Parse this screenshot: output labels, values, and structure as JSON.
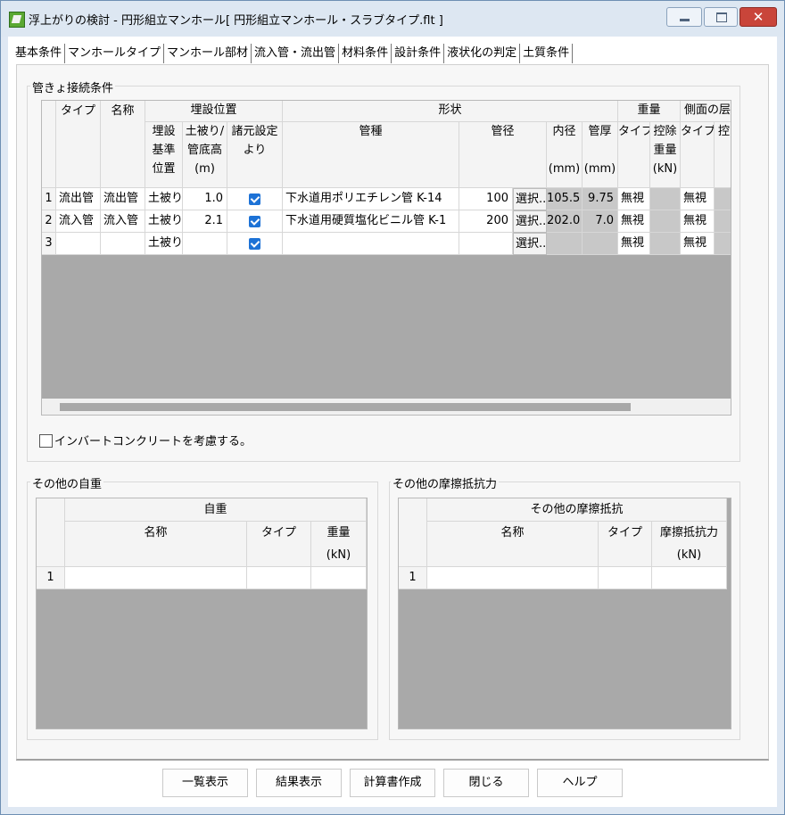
{
  "window": {
    "title": "浮上がりの検討 - 円形組立マンホール[ 円形組立マンホール・スラブタイプ.flt ]",
    "close_glyph": "✕",
    "icon": "app-icon"
  },
  "tabs": [
    "基本条件",
    "マンホールタイプ",
    "マンホール部材",
    "流入管・流出管",
    "材料条件",
    "設計条件",
    "液状化の判定",
    "土質条件"
  ],
  "active_tab": "流入管・流出管",
  "pipe_section": {
    "label": "管きょ接続条件",
    "header_groups": [
      "タイプ",
      "名称",
      "埋設位置",
      "形状",
      "重量",
      "側面の层"
    ],
    "sub_headers": {
      "burial_basis": [
        "埋設",
        "基準",
        "位置"
      ],
      "cover": [
        "土被り/",
        "管底高",
        "(m)"
      ],
      "from_settings": [
        "諸元設定",
        "より"
      ],
      "pipe_type": "管種",
      "pipe_dia": "管径",
      "inner_dia": [
        "内径",
        "(mm)"
      ],
      "thickness": [
        "管厚",
        "(mm)"
      ],
      "weight_type": "タイプ",
      "deduct_weight": [
        "控除",
        "重量",
        "(kN)"
      ],
      "side_type": "タイプ",
      "side_partial": "控"
    },
    "rows": [
      {
        "no": "1",
        "type": "流出管",
        "name": "流出管",
        "basis": "土被り",
        "cover": "1.0",
        "checked": true,
        "pipe": "下水道用ポリエチレン管 K-14",
        "dia": "100",
        "select": "選択...",
        "inner": "105.5",
        "thick": "9.75",
        "wtype": "無視",
        "deduct": "",
        "stype": "無視"
      },
      {
        "no": "2",
        "type": "流入管",
        "name": "流入管",
        "basis": "土被り",
        "cover": "2.1",
        "checked": true,
        "pipe": "下水道用硬質塩化ビニル管 K-1",
        "dia": "200",
        "select": "選択...",
        "inner": "202.0",
        "thick": "7.0",
        "wtype": "無視",
        "deduct": "",
        "stype": "無視"
      },
      {
        "no": "3",
        "type": "",
        "name": "",
        "basis": "土被り",
        "cover": "",
        "checked": true,
        "pipe": "",
        "dia": "",
        "select": "選択...",
        "inner": "",
        "thick": "",
        "wtype": "無視",
        "deduct": "",
        "stype": "無視"
      }
    ]
  },
  "invert_checkbox": {
    "label": "インバートコンクリートを考慮する。",
    "checked": false
  },
  "self_weight": {
    "label": "その他の自重",
    "group_header": "自重",
    "col_name": "名称",
    "col_type": "タイプ",
    "col_weight": [
      "重量",
      "(kN)"
    ],
    "row_no": "1"
  },
  "friction": {
    "label": "その他の摩擦抵抗力",
    "group_header": "その他の摩擦抵抗",
    "col_name": "名称",
    "col_type": "タイプ",
    "col_force": [
      "摩擦抵抗力",
      "(kN)"
    ],
    "row_no": "1"
  },
  "buttons": {
    "list": "一覧表示",
    "result": "結果表示",
    "report": "計算書作成",
    "close": "閉じる",
    "help": "ヘルプ"
  }
}
